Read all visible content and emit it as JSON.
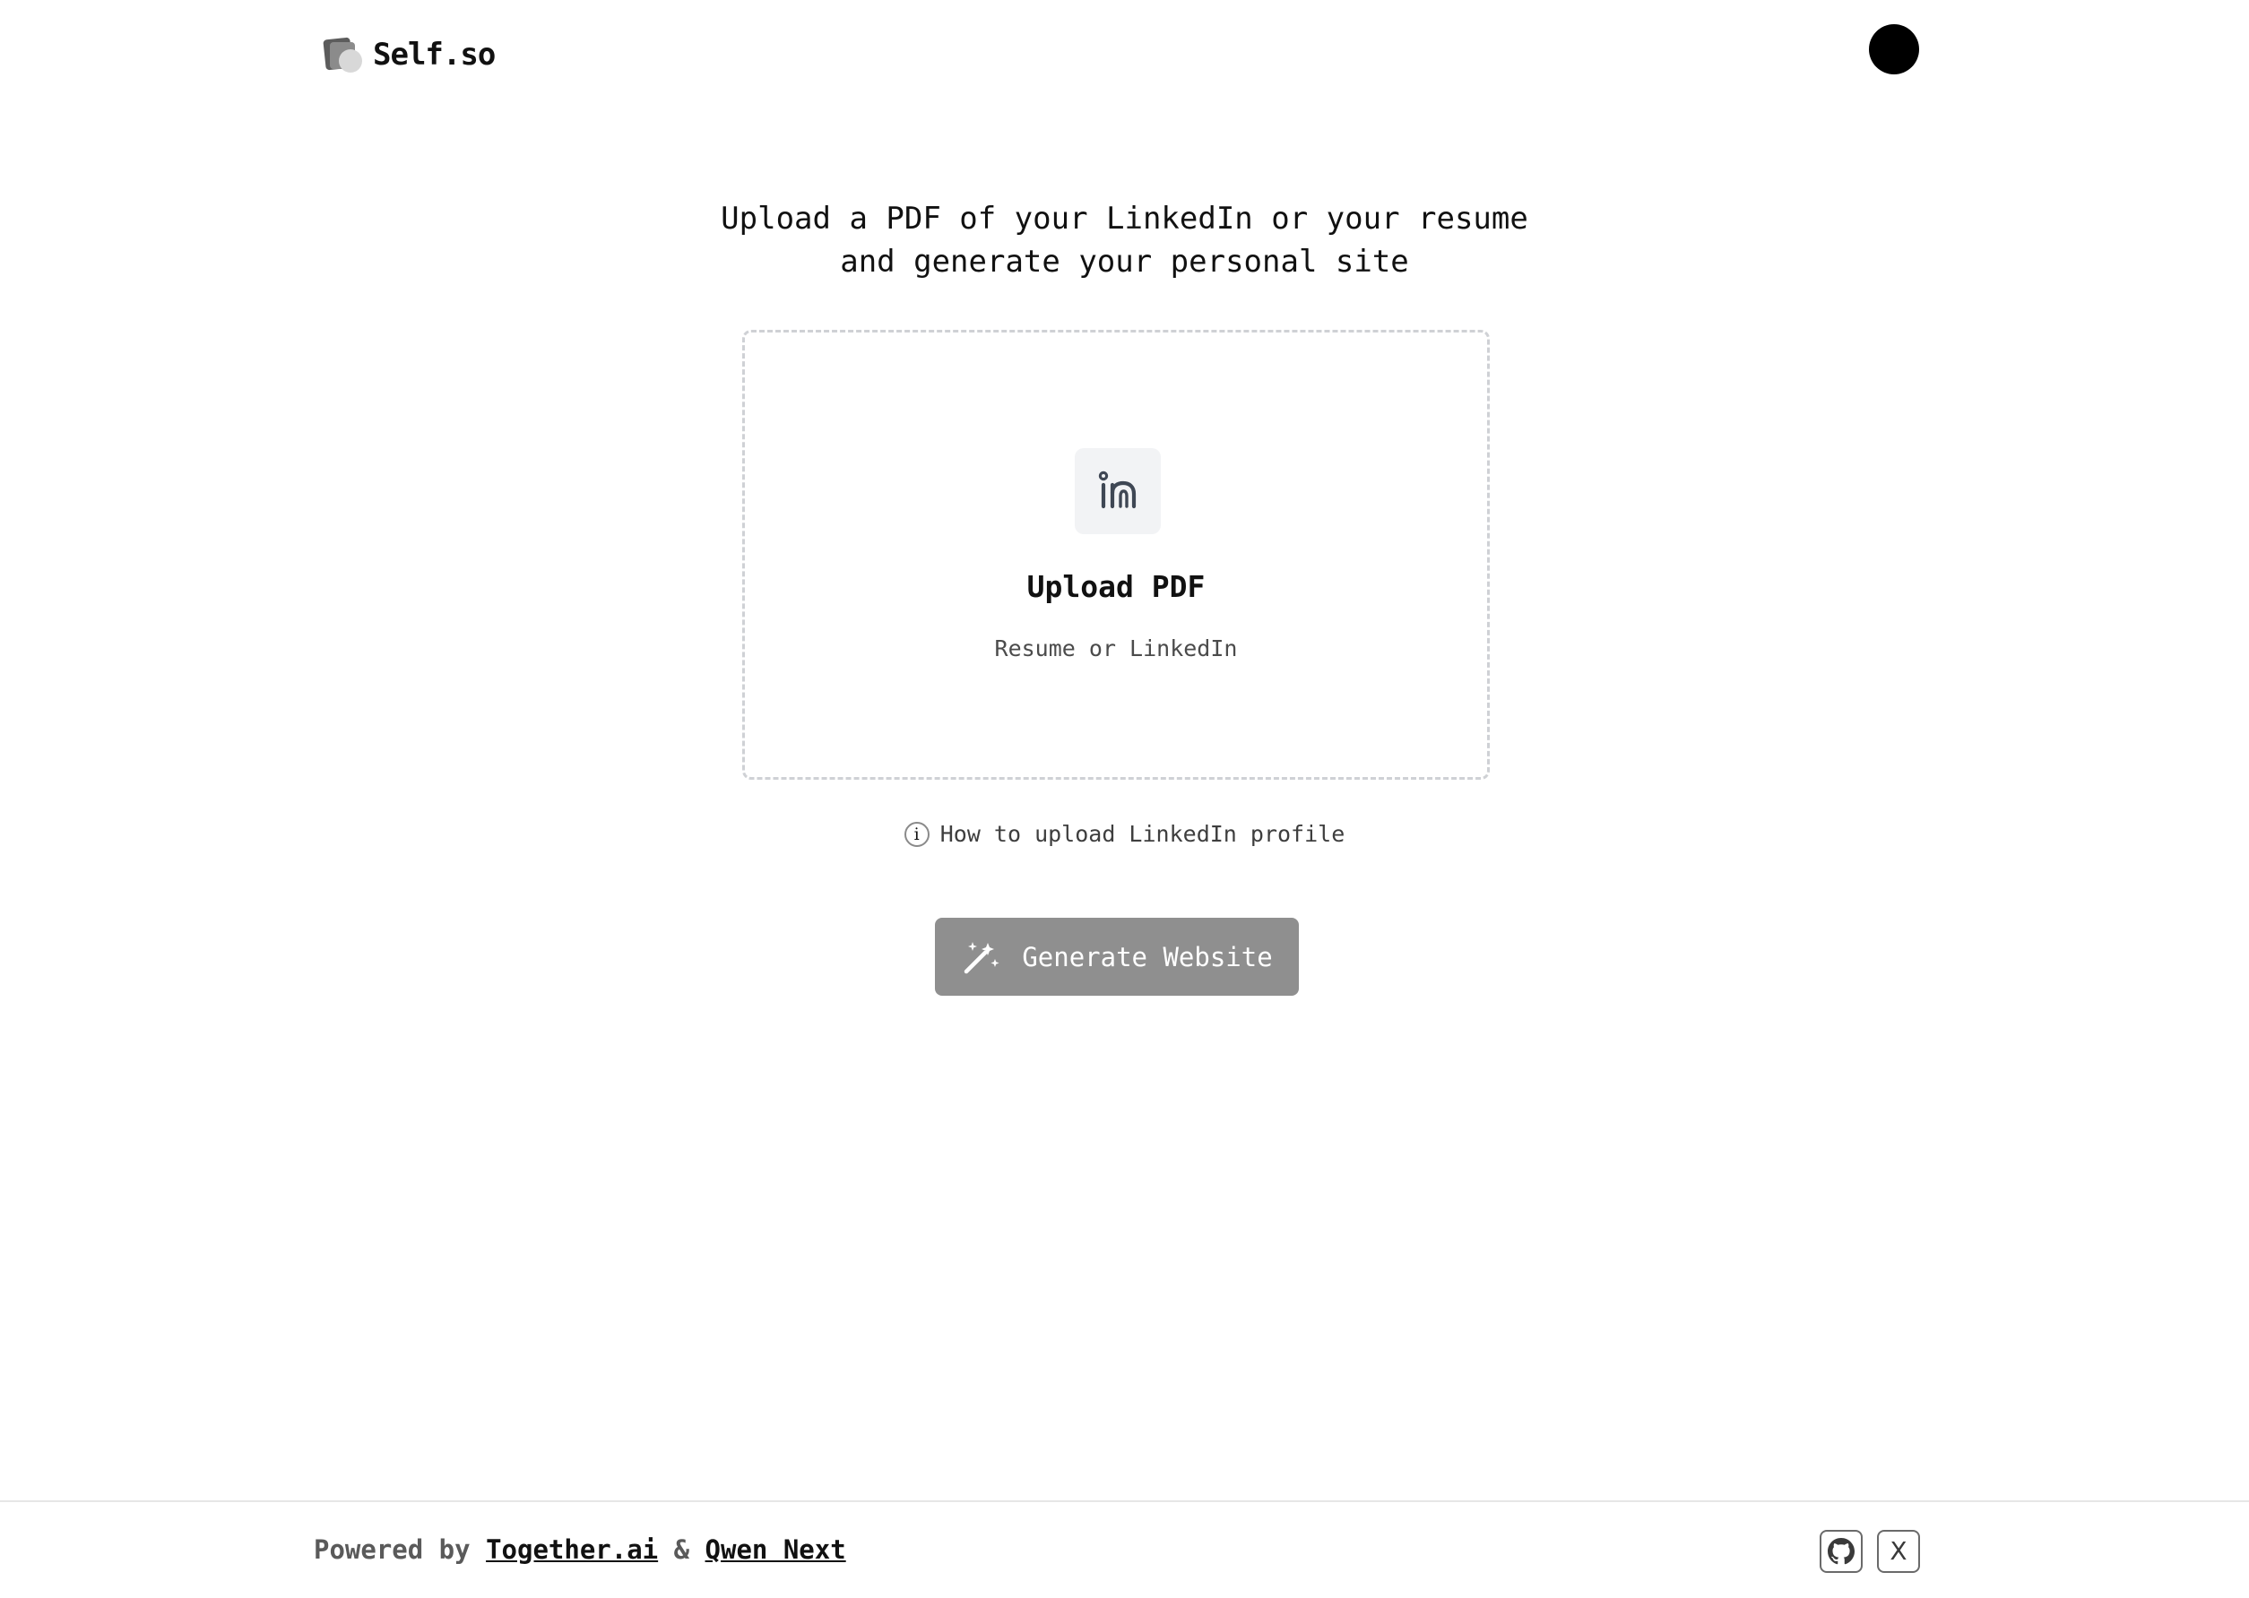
{
  "header": {
    "brand_name": "Self.so"
  },
  "main": {
    "headline_line1": "Upload a PDF of your LinkedIn or your resume",
    "headline_line2": "and generate your personal site",
    "dropzone": {
      "icon": "linkedin-icon",
      "title": "Upload PDF",
      "subtitle": "Resume or LinkedIn"
    },
    "help_link": "How to upload LinkedIn profile",
    "generate_button": "Generate Website"
  },
  "footer": {
    "powered_by": "Powered by",
    "link1": "Together.ai",
    "separator": "&",
    "link2": "Qwen Next",
    "github_icon": "github-icon",
    "x_icon": "x-icon",
    "x_label": "X"
  },
  "colors": {
    "button_bg": "#8f8f8f",
    "dropzone_border": "#cfd1d5",
    "icon_tile_bg": "#f2f3f5",
    "avatar": "#000000"
  }
}
